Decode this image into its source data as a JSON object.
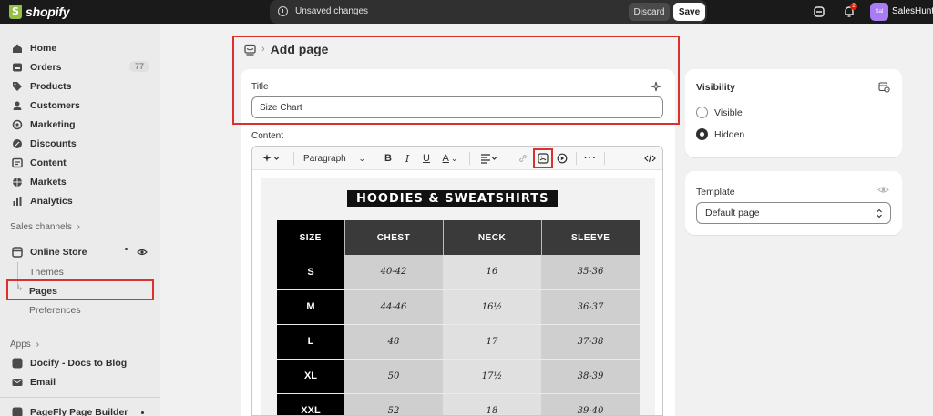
{
  "topbar": {
    "brand": "shopify",
    "unsaved_text": "Unsaved changes",
    "discard_label": "Discard",
    "save_label": "Save",
    "notification_count": "2",
    "avatar_initials": "Sal",
    "store_name": "SalesHunt"
  },
  "sidebar": {
    "items": [
      {
        "label": "Home",
        "icon": "home-icon"
      },
      {
        "label": "Orders",
        "icon": "orders-icon",
        "badge": "77"
      },
      {
        "label": "Products",
        "icon": "tag-icon"
      },
      {
        "label": "Customers",
        "icon": "person-icon"
      },
      {
        "label": "Marketing",
        "icon": "target-icon"
      },
      {
        "label": "Discounts",
        "icon": "discount-icon"
      },
      {
        "label": "Content",
        "icon": "content-icon"
      },
      {
        "label": "Markets",
        "icon": "globe-icon"
      },
      {
        "label": "Analytics",
        "icon": "chart-icon"
      }
    ],
    "sales_channels_label": "Sales channels",
    "online_store_label": "Online Store",
    "online_store_sub": [
      "Themes",
      "Pages",
      "Preferences"
    ],
    "apps_label": "Apps",
    "apps": [
      "Docify - Docs to Blog",
      "Email",
      "PageFly Page Builder"
    ]
  },
  "header": {
    "title": "Add page"
  },
  "title_field": {
    "label": "Title",
    "value": "Size Chart"
  },
  "content_field": {
    "label": "Content",
    "paragraph_select": "Paragraph"
  },
  "size_chart": {
    "heading": "HOODIES & SWEATSHIRTS",
    "columns": [
      "SIZE",
      "CHEST",
      "NECK",
      "SLEEVE"
    ],
    "rows": [
      [
        "S",
        "40-42",
        "16",
        "35-36"
      ],
      [
        "M",
        "44-46",
        "16½",
        "36-37"
      ],
      [
        "L",
        "48",
        "17",
        "37-38"
      ],
      [
        "XL",
        "50",
        "17½",
        "38-39"
      ],
      [
        "XXL",
        "52",
        "18",
        "39-40"
      ]
    ]
  },
  "visibility": {
    "title": "Visibility",
    "options": [
      "Visible",
      "Hidden"
    ],
    "selected": "Hidden"
  },
  "template": {
    "title": "Template",
    "value": "Default page"
  },
  "colors": {
    "highlight": "#d9312b",
    "topbar": "#1a1a1a",
    "avatar": "#a77cf5"
  }
}
